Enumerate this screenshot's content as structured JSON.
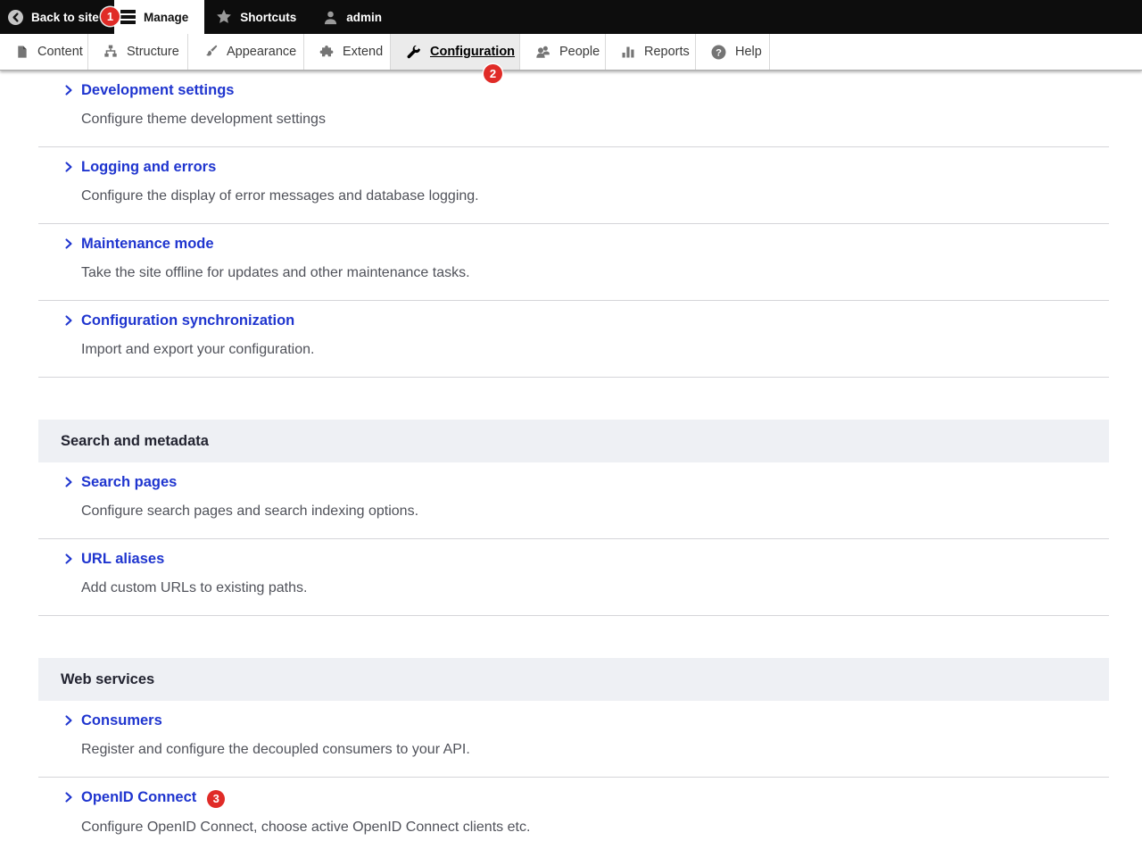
{
  "admin_toolbar": {
    "back_to_site": "Back to site",
    "manage": "Manage",
    "shortcuts": "Shortcuts",
    "user": "admin"
  },
  "menu_tabs": [
    {
      "label": "Content",
      "icon": "file-icon"
    },
    {
      "label": "Structure",
      "icon": "sitemap-icon"
    },
    {
      "label": "Appearance",
      "icon": "paintbrush-icon"
    },
    {
      "label": "Extend",
      "icon": "puzzle-icon"
    },
    {
      "label": "Configuration",
      "icon": "wrench-icon",
      "active": true
    },
    {
      "label": "People",
      "icon": "people-icon"
    },
    {
      "label": "Reports",
      "icon": "bar-chart-icon"
    },
    {
      "label": "Help",
      "icon": "question-icon"
    }
  ],
  "annotations": {
    "mark1": "1",
    "mark2": "2",
    "mark3": "3"
  },
  "sections": [
    {
      "header": "",
      "items": [
        {
          "title": "Development settings",
          "description": "Configure theme development settings"
        },
        {
          "title": "Logging and errors",
          "description": "Configure the display of error messages and database logging."
        },
        {
          "title": "Maintenance mode",
          "description": "Take the site offline for updates and other maintenance tasks."
        },
        {
          "title": "Configuration synchronization",
          "description": "Import and export your configuration."
        }
      ]
    },
    {
      "header": "Search and metadata",
      "items": [
        {
          "title": "Search pages",
          "description": "Configure search pages and search indexing options."
        },
        {
          "title": "URL aliases",
          "description": "Add custom URLs to existing paths."
        }
      ]
    },
    {
      "header": "Web services",
      "items": [
        {
          "title": "Consumers",
          "description": "Register and configure the decoupled consumers to your API."
        },
        {
          "title": "OpenID Connect",
          "description": "Configure OpenID Connect, choose active OpenID Connect clients etc."
        }
      ]
    }
  ],
  "colors": {
    "link_blue": "#1f35cf",
    "annotation_red": "#e02b27",
    "section_header_bg": "#eef0f4",
    "admin_toolbar_bg": "#0d0d0d"
  }
}
